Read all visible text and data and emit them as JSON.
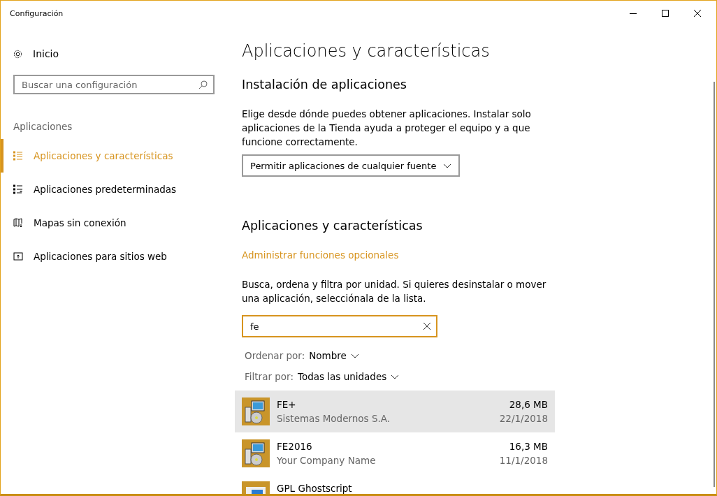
{
  "window": {
    "title": "Configuración"
  },
  "sidebar": {
    "home": "Inicio",
    "search": {
      "placeholder": "Buscar una configuración"
    },
    "section": "Aplicaciones",
    "items": [
      {
        "label": "Aplicaciones y características",
        "kind": "list",
        "selected": true
      },
      {
        "label": "Aplicaciones predeterminadas",
        "kind": "defaults",
        "selected": false
      },
      {
        "label": "Mapas sin conexión",
        "kind": "map",
        "selected": false
      },
      {
        "label": "Aplicaciones para sitios web",
        "kind": "web",
        "selected": false
      }
    ]
  },
  "main": {
    "title": "Aplicaciones y características",
    "install": {
      "heading": "Instalación de aplicaciones",
      "description": "Elige desde dónde puedes obtener aplicaciones. Instalar solo aplicaciones de la Tienda ayuda a proteger el equipo y a que funcione correctamente.",
      "dropdown": "Permitir aplicaciones de cualquier fuente"
    },
    "apps": {
      "heading": "Aplicaciones y características",
      "link": "Administrar funciones opcionales",
      "description": "Busca, ordena y filtra por unidad. Si quieres desinstalar o mover una aplicación, selecciónala de la lista.",
      "search": {
        "value": "fe"
      },
      "sort": {
        "label": "Ordenar por:",
        "value": "Nombre"
      },
      "filter": {
        "label": "Filtrar por:",
        "value": "Todas las unidades"
      },
      "list": [
        {
          "name": "FE+",
          "publisher": "Sistemas Modernos S.A.",
          "size": "28,6 MB",
          "date": "22/1/2018",
          "kind": "installer",
          "selected": true
        },
        {
          "name": "FE2016",
          "publisher": "Your Company Name",
          "size": "16,3 MB",
          "date": "11/1/2018",
          "kind": "installer",
          "selected": false
        },
        {
          "name": "GPL Ghostscript",
          "kind": "window",
          "selected": false
        }
      ]
    }
  }
}
